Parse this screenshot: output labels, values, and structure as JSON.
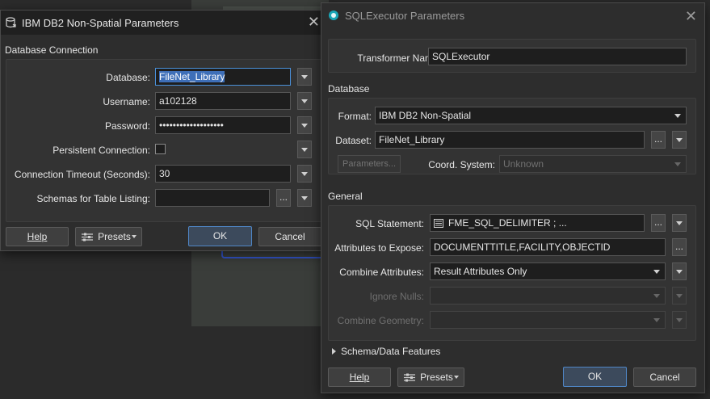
{
  "db2_dialog": {
    "title": "IBM DB2 Non-Spatial Parameters",
    "close_glyph": "✕",
    "section": "Database Connection",
    "fields": {
      "database_label": "Database:",
      "database_value": "FileNet_Library",
      "username_label": "Username:",
      "username_value": "a102128",
      "password_label": "Password:",
      "password_value": "•••••••••••••••••••",
      "persistent_label": "Persistent Connection:",
      "timeout_label": "Connection Timeout (Seconds):",
      "timeout_value": "30",
      "schemas_label": "Schemas for Table Listing:",
      "schemas_value": ""
    },
    "buttons": {
      "help": "Help",
      "presets": "Presets",
      "ok": "OK",
      "cancel": "Cancel"
    }
  },
  "sql_dialog": {
    "title": "SQLExecutor Parameters",
    "close_glyph": "✕",
    "transformer_label": "Transformer Name:",
    "transformer_value": "SQLExecutor",
    "database_section": "Database",
    "format_label": "Format:",
    "format_value": "IBM DB2 Non-Spatial",
    "dataset_label": "Dataset:",
    "dataset_value": "FileNet_Library",
    "parameters_button": "Parameters...",
    "coord_label": "Coord. System:",
    "coord_value": "Unknown",
    "general_section": "General",
    "sql_label": "SQL Statement:",
    "sql_value": "FME_SQL_DELIMITER ; ...",
    "attrs_label": "Attributes to Expose:",
    "attrs_value": "DOCUMENTTITLE,FACILITY,OBJECTID",
    "combine_label": "Combine Attributes:",
    "combine_value": "Result Attributes Only",
    "ignore_label": "Ignore Nulls:",
    "geometry_label": "Combine Geometry:",
    "schema_section": "Schema/Data Features",
    "ellipsis": "...",
    "buttons": {
      "help": "Help",
      "presets": "Presets",
      "ok": "OK",
      "cancel": "Cancel"
    }
  },
  "colors": {
    "accent": "#4a90d9",
    "background": "#2d2d2d",
    "field": "#1e1e1e"
  }
}
